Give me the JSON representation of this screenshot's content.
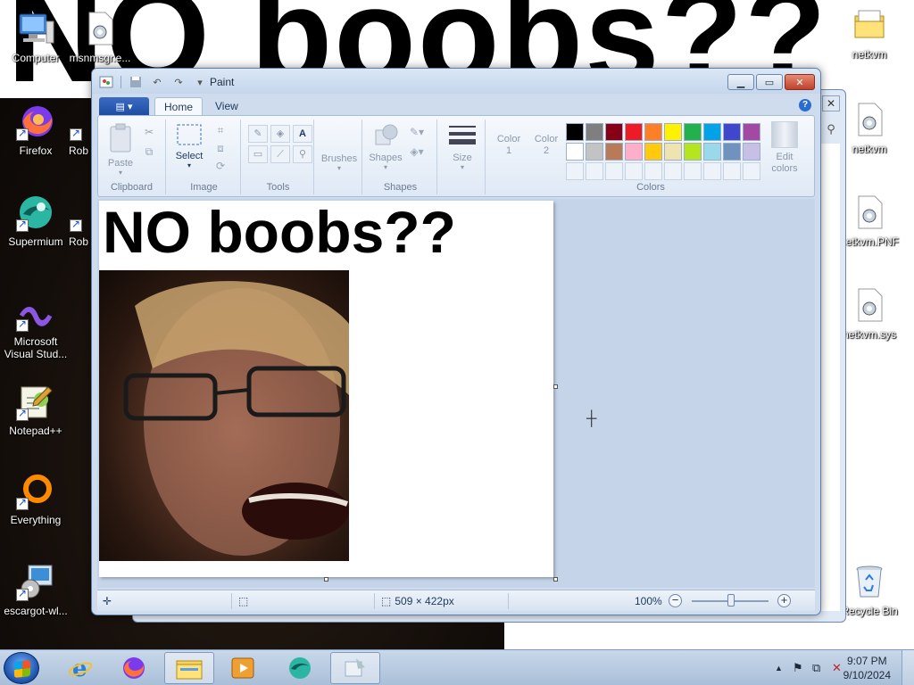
{
  "wallpaper": {
    "headline": "NO boobs??"
  },
  "desktop_icons": {
    "computer": "Computer",
    "msnmsgr": "msnmsgr.e...",
    "firefox": "Firefox",
    "rob1": "Rob",
    "supermium": "Supermium",
    "rob2": "Rob",
    "vs": "Microsoft Visual Stud...",
    "notepadpp": "Notepad++",
    "everything": "Everything",
    "escargot": "escargot-wl...",
    "netkvm1": "netkvm",
    "netkvm2": "netkvm",
    "netkvm_pnf": "netkvm.PNF",
    "netkvm_sys": "netkvm.sys",
    "recycle": "Recycle Bin"
  },
  "paint": {
    "title": "Paint",
    "tabs": {
      "home": "Home",
      "view": "View"
    },
    "help": "?",
    "ribbon": {
      "clipboard": {
        "label": "Clipboard",
        "paste": "Paste"
      },
      "image": {
        "label": "Image",
        "select": "Select"
      },
      "tools": {
        "label": "Tools"
      },
      "brushes": {
        "label": "Brushes"
      },
      "shapes": {
        "label": "Shapes",
        "shapes_btn": "Shapes"
      },
      "size": {
        "label": "Size"
      },
      "colors": {
        "label": "Colors",
        "color1": "Color 1",
        "color2": "Color 2",
        "edit": "Edit colors",
        "palette_row1": [
          "#000000",
          "#7f7f7f",
          "#880015",
          "#ed1c24",
          "#ff7f27",
          "#fff200",
          "#22b14c",
          "#00a2e8",
          "#3f48cc",
          "#a349a4"
        ],
        "palette_row2": [
          "#ffffff",
          "#c3c3c3",
          "#b97a57",
          "#ffaec9",
          "#ffc90e",
          "#efe4b0",
          "#b5e61d",
          "#99d9ea",
          "#7092be",
          "#c8bfe7"
        ]
      }
    },
    "canvas": {
      "text": "NO boobs??"
    },
    "status": {
      "size": "509 × 422px",
      "zoom": "100%"
    }
  },
  "taskbar": {
    "time": "9:07 PM",
    "date": "9/10/2024"
  }
}
